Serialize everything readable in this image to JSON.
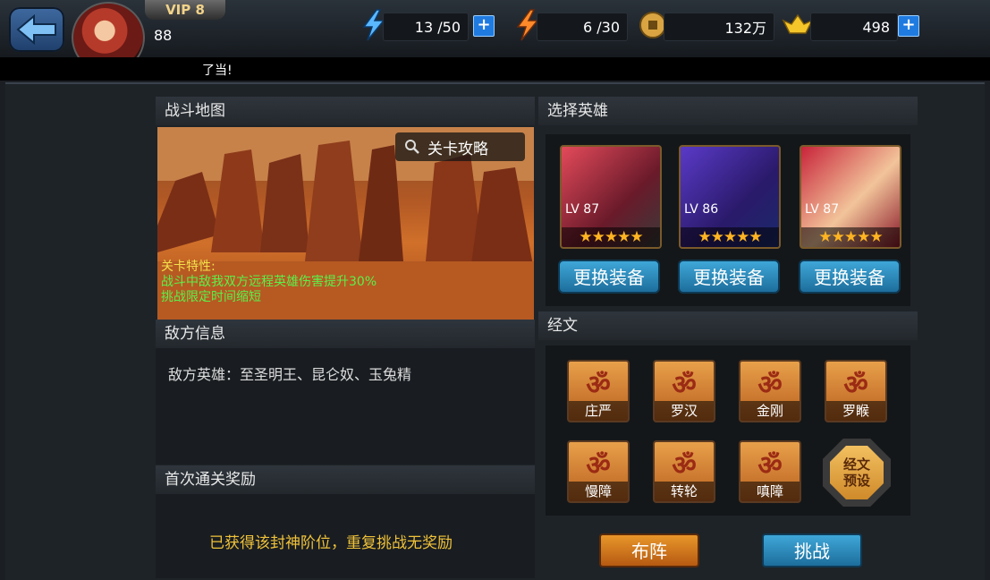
{
  "header": {
    "vip": "VIP 8",
    "level": "88",
    "stamina": {
      "icon": "stamina-lightning-icon",
      "value": "13 /50"
    },
    "activity": {
      "icon": "activity-lightning-icon",
      "value": "6 /30"
    },
    "coins": {
      "icon": "coin-icon",
      "value": "132万"
    },
    "gold": {
      "icon": "gold-ingot-icon",
      "value": "498"
    },
    "plus": "+"
  },
  "ticker": {
    "text": "了当!"
  },
  "battle_map": {
    "title": "战斗地图",
    "guide_label": "关卡攻略",
    "traits_heading": "关卡特性:",
    "traits": [
      "战斗中敌我双方远程英雄伤害提升30%",
      "挑战限定时间缩短"
    ]
  },
  "enemy_info": {
    "title": "敌方信息",
    "text": "敌方英雄：至圣明王、昆仑奴、玉兔精"
  },
  "first_clear": {
    "title": "首次通关奖励",
    "text": "已获得该封神阶位，重复挑战无奖励"
  },
  "select_hero": {
    "title": "选择英雄",
    "heroes": [
      {
        "level": "LV 87",
        "stars": "★★★★★",
        "button": "更换装备"
      },
      {
        "level": "LV 86",
        "stars": "★★★★★",
        "button": "更换装备"
      },
      {
        "level": "LV 87",
        "stars": "★★★★★",
        "button": "更换装备"
      }
    ]
  },
  "scriptures": {
    "title": "经文",
    "items": [
      {
        "label": "庄严",
        "glyph": "ॐ"
      },
      {
        "label": "罗汉",
        "glyph": "ॐ"
      },
      {
        "label": "金刚",
        "glyph": "ॐ"
      },
      {
        "label": "罗睺",
        "glyph": "ॐ"
      },
      {
        "label": "慢障",
        "glyph": "ॐ"
      },
      {
        "label": "转轮",
        "glyph": "ॐ"
      },
      {
        "label": "嗔障",
        "glyph": "ॐ"
      }
    ],
    "preset_label": "经文\n预设"
  },
  "actions": {
    "formation": "布阵",
    "challenge": "挑战"
  },
  "colors": {
    "accent_blue": "#1f7be0",
    "trait_green": "#5cf04a",
    "reward_yellow": "#f0c23a"
  }
}
